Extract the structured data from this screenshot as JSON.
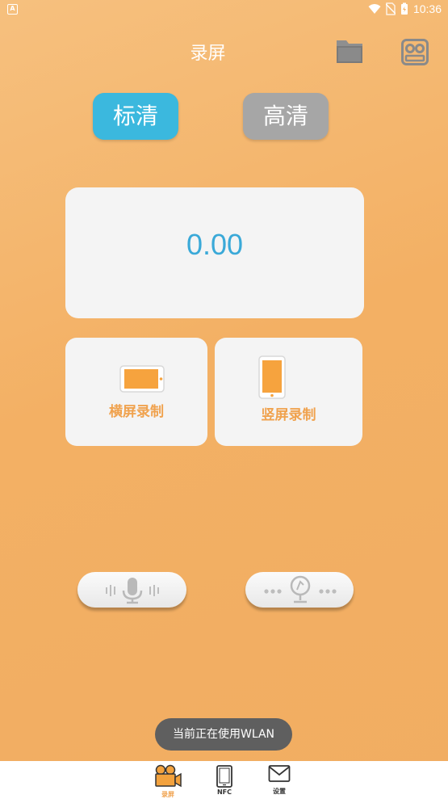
{
  "status_bar": {
    "time": "10:36",
    "notification_icon": "app-notification-icon"
  },
  "header": {
    "title": "录屏",
    "folder_icon": "folder-icon",
    "recorder_icon": "tape-recorder-icon"
  },
  "quality": {
    "sd_label": "标清",
    "hd_label": "高清",
    "selected": "sd"
  },
  "timer": {
    "value": "0.00"
  },
  "record": {
    "landscape_label": "横屏录制",
    "portrait_label": "竖屏录制"
  },
  "audio": {
    "mic_icon": "microphone-icon",
    "system_icon": "system-audio-icon"
  },
  "toast": {
    "message": "当前正在使用WLAN"
  },
  "nav": {
    "items": [
      {
        "label": "录屏",
        "icon": "camera-icon",
        "active": true
      },
      {
        "label": "NFC",
        "icon": "phone-icon",
        "active": false
      },
      {
        "label": "设置",
        "icon": "mail-icon",
        "active": false
      }
    ]
  },
  "colors": {
    "accent_blue": "#3bb8de",
    "orange": "#f0a24e",
    "bg": "#f3b064"
  }
}
